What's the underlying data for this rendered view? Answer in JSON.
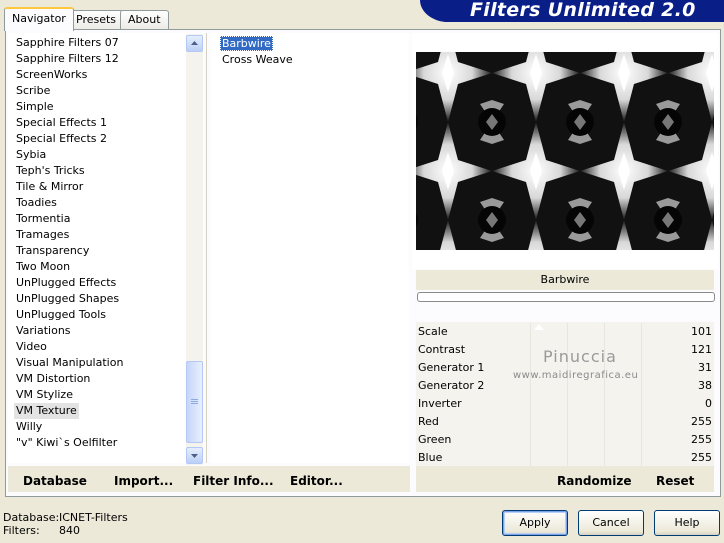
{
  "tabs": [
    "Navigator",
    "Presets",
    "About"
  ],
  "header": {
    "title": "Filters Unlimited 2.0"
  },
  "categories": {
    "items": [
      "Sapphire Filters 07",
      "Sapphire Filters 12",
      "ScreenWorks",
      "Scribe",
      "Simple",
      "Special Effects 1",
      "Special Effects 2",
      "Sybia",
      "Teph's Tricks",
      "Tile & Mirror",
      "Toadies",
      "Tormentia",
      "Tramages",
      "Transparency",
      "Two Moon",
      "UnPlugged Effects",
      "UnPlugged Shapes",
      "UnPlugged Tools",
      "Variations",
      "Video",
      "Visual Manipulation",
      "VM Distortion",
      "VM Stylize",
      "VM Texture",
      "Willy",
      "\"v\" Kiwi`s Oelfilter"
    ],
    "selected": "VM Texture"
  },
  "filters": {
    "items": [
      "Barbwire",
      "Cross Weave"
    ],
    "selected": "Barbwire"
  },
  "preview": {
    "filter_name": "Barbwire"
  },
  "params": [
    {
      "name": "Scale",
      "value": "101"
    },
    {
      "name": "Contrast",
      "value": "121"
    },
    {
      "name": "Generator 1",
      "value": "31"
    },
    {
      "name": "Generator 2",
      "value": "38"
    },
    {
      "name": "Inverter",
      "value": "0"
    },
    {
      "name": "Red",
      "value": "255"
    },
    {
      "name": "Green",
      "value": "255"
    },
    {
      "name": "Blue",
      "value": "255"
    }
  ],
  "watermark": {
    "name": "Pinuccia",
    "url": "www.maidiregrafica.eu"
  },
  "toolbar": {
    "database": "Database",
    "import": "Import...",
    "filter_info": "Filter Info...",
    "editor": "Editor...",
    "randomize": "Randomize",
    "reset": "Reset"
  },
  "footer": {
    "database_label": "Database:",
    "database_value": "ICNET-Filters",
    "filters_label": "Filters:",
    "filters_value": "840"
  },
  "buttons": {
    "apply": "Apply",
    "cancel": "Cancel",
    "help": "Help"
  },
  "colors": {
    "banner": "#0a1e88",
    "selection": "#316ac5",
    "window": "#ece9d8"
  },
  "icons": {
    "scroll_up": "triangle-up-icon",
    "scroll_down": "triangle-down-icon"
  }
}
